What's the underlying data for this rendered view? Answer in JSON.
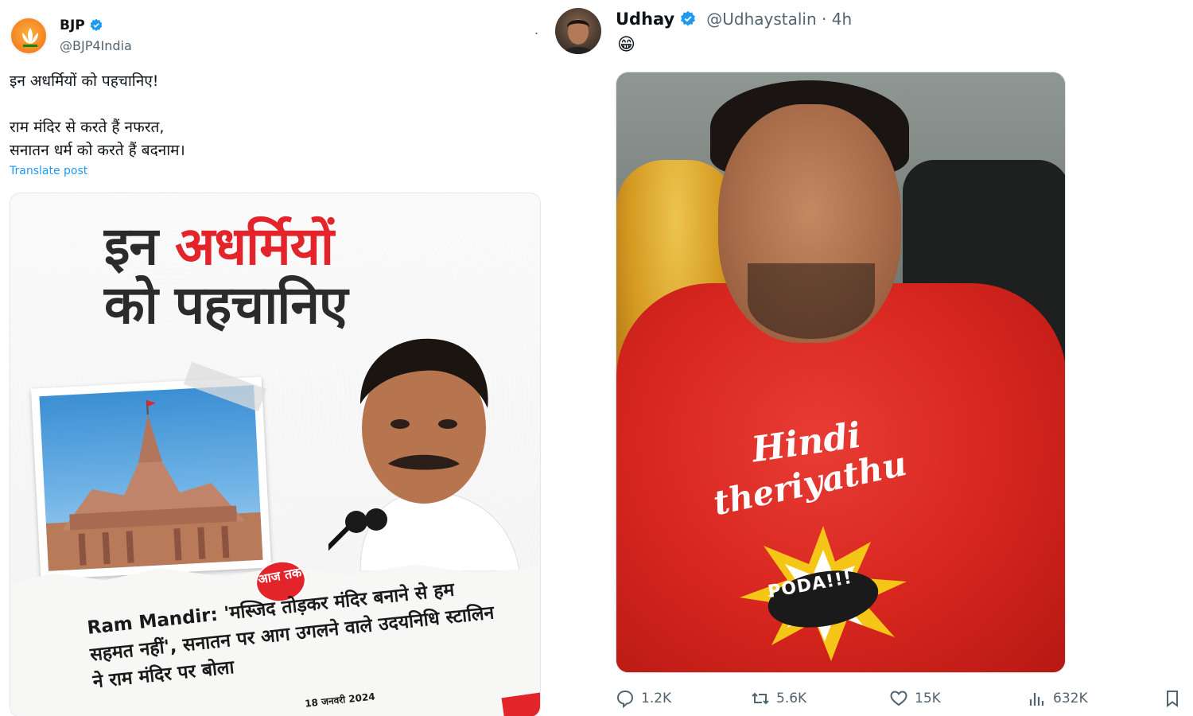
{
  "left_tweet": {
    "author_name": "BJP",
    "handle": "@BJP4India",
    "more_menu": ".",
    "text": "इन अधर्मियों को पहचानिए!\n\nराम मंदिर से करते हैं नफरत,\nसनातन धर्म को करते हैं बदनाम।",
    "translate_label": "Translate post",
    "media": {
      "headline_black_1": "इन",
      "headline_red": "अधर्मियों",
      "headline_line2": "को पहचानिए",
      "logo_text": "आज तक",
      "caption": "Ram Mandir: 'मस्जिद तोड़कर मंदिर बनाने से हम सहमत नहीं', सनातन पर आग उगलने वाले उदयनिधि स्टालिन ने राम मंदिर पर बोला",
      "date": "18 जनवरी 2024"
    }
  },
  "right_tweet": {
    "author_name": "Udhay",
    "handle_time": "@Udhaystalin · 4h",
    "emoji": "😁",
    "media": {
      "shirt_line1": "Hindi",
      "shirt_line2": "theriyathu",
      "shirt_burst": "PODA!!!"
    },
    "actions": {
      "replies": "1.2K",
      "reposts": "5.6K",
      "likes": "15K",
      "views": "632K"
    }
  },
  "colors": {
    "accent": "#1d9bf0",
    "brand_red": "#e3242b",
    "text_secondary": "#536471"
  },
  "icons": [
    "verified-badge-icon",
    "reply-icon",
    "repost-icon",
    "like-icon",
    "views-icon",
    "bookmark-icon"
  ]
}
